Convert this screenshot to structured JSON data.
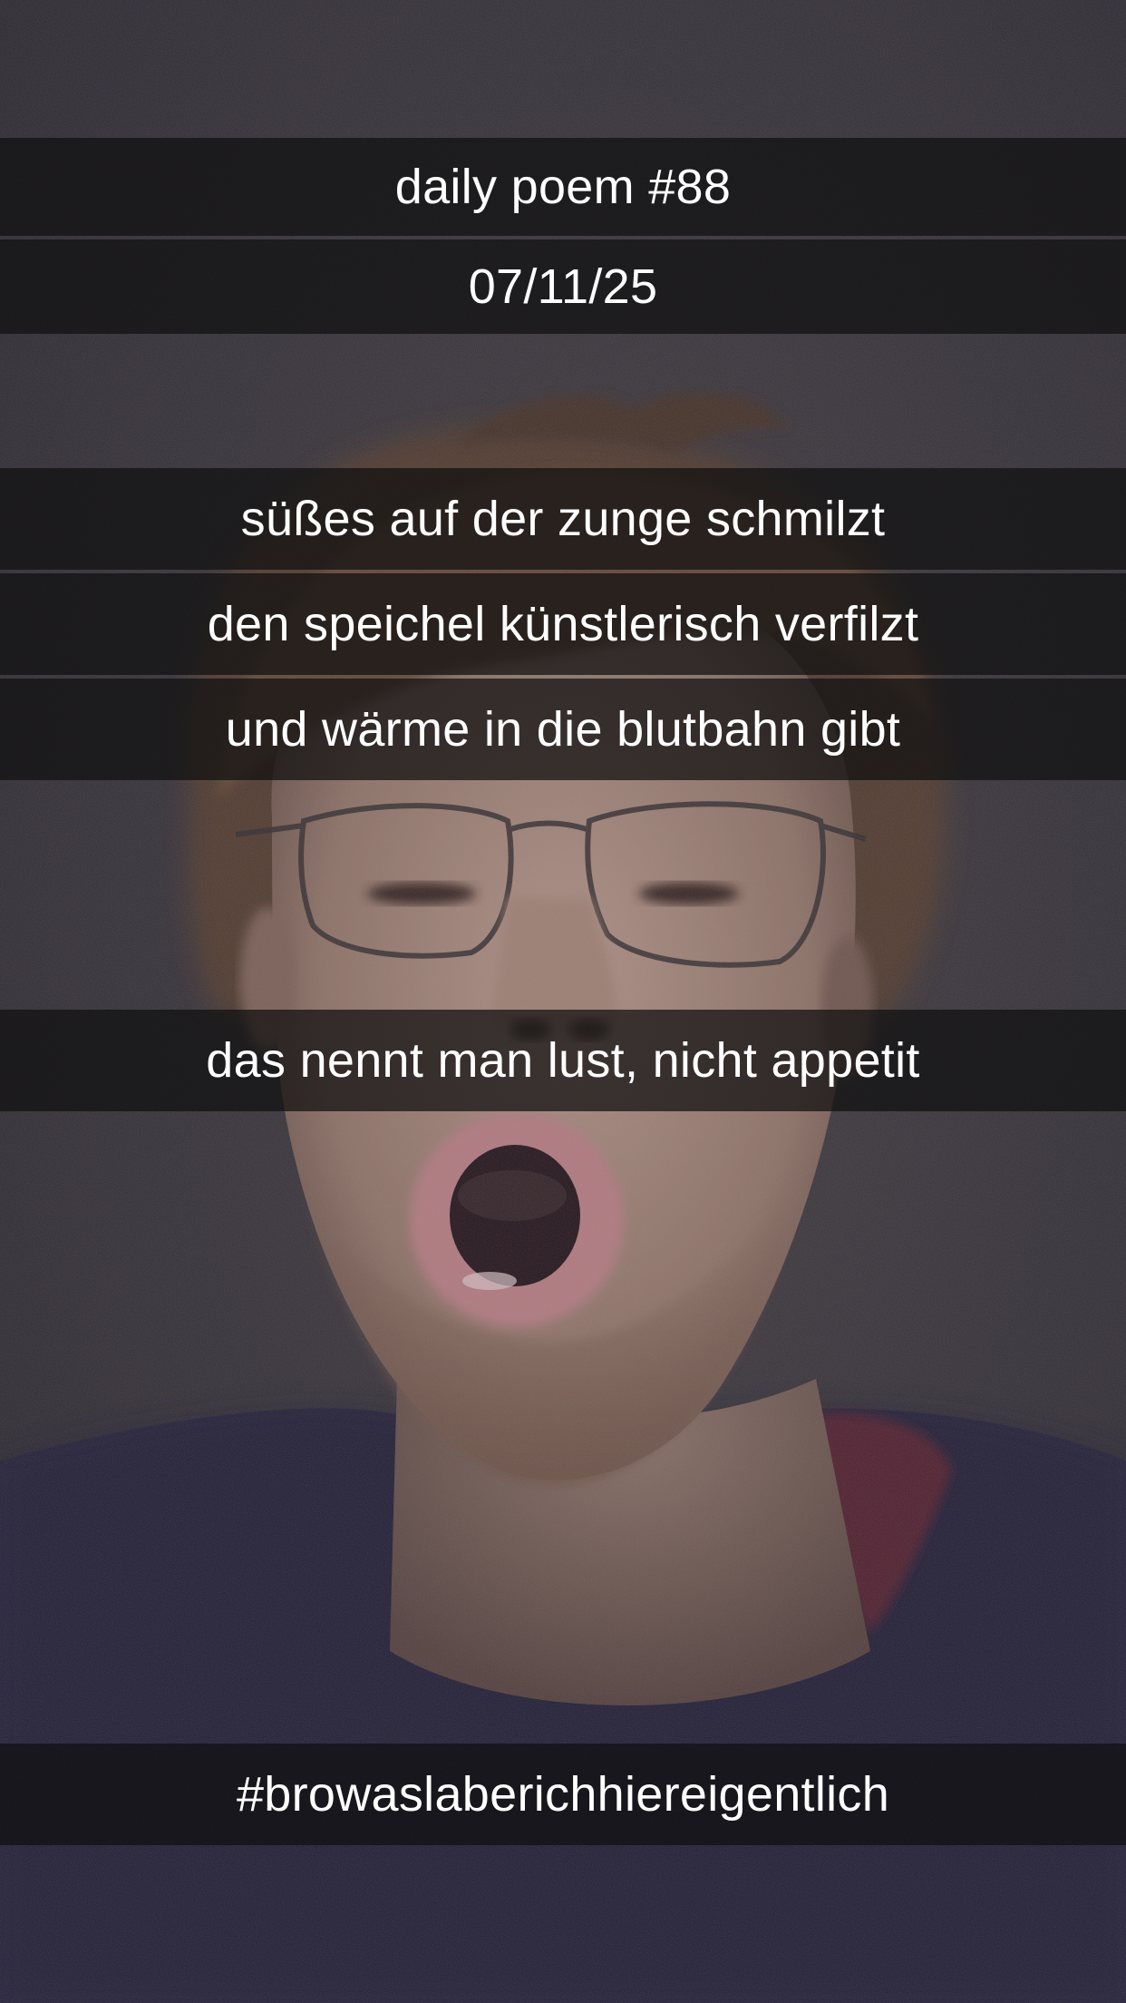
{
  "story": {
    "title": "daily poem #88",
    "date": "07/11/25",
    "poem_lines": [
      "süßes auf der zunge schmilzt",
      "den speichel künstlerisch verfilzt",
      "und wärme in die blutbahn gibt",
      "das nennt man lust, nicht appetit"
    ],
    "hashtag": "#browaslaberichhiereigentlich"
  },
  "photo": {
    "subject": "selfie of a young man with glasses and open mouth",
    "colors": {
      "wall": "#3b3b3d",
      "skin": "#b89a86",
      "hair": "#6b5138",
      "shirt": "#2c2a3e",
      "lips": "#c98c8e"
    }
  }
}
